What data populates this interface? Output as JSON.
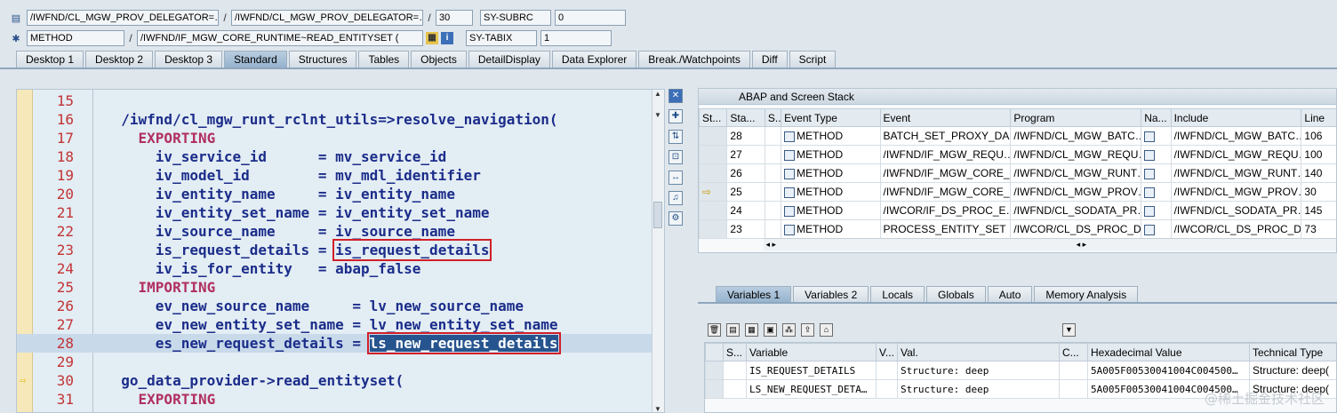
{
  "header": {
    "row1": {
      "field1": "/IWFND/CL_MGW_PROV_DELEGATOR=…",
      "field2": "/IWFND/CL_MGW_PROV_DELEGATOR=…",
      "field3": "30",
      "sysvar_label": "SY-SUBRC",
      "sysvar_value": "0"
    },
    "row2": {
      "field1": "METHOD",
      "field2": "/IWFND/IF_MGW_CORE_RUNTIME~READ_ENTITYSET (",
      "sysvar_label": "SY-TABIX",
      "sysvar_value": "1"
    }
  },
  "tabs": [
    "Desktop 1",
    "Desktop 2",
    "Desktop 3",
    "Standard",
    "Structures",
    "Tables",
    "Objects",
    "DetailDisplay",
    "Data Explorer",
    "Break./Watchpoints",
    "Diff",
    "Script"
  ],
  "active_tab": "Standard",
  "code": {
    "lines": [
      {
        "n": "15",
        "t": ""
      },
      {
        "n": "16",
        "t": "  /iwfnd/cl_mgw_runt_rclnt_utils=>resolve_navigation("
      },
      {
        "n": "17",
        "t": "    EXPORTING"
      },
      {
        "n": "18",
        "t": "      iv_service_id      = mv_service_id"
      },
      {
        "n": "19",
        "t": "      iv_model_id        = mv_mdl_identifier"
      },
      {
        "n": "20",
        "t": "      iv_entity_name     = iv_entity_name"
      },
      {
        "n": "21",
        "t": "      iv_entity_set_name = iv_entity_set_name"
      },
      {
        "n": "22",
        "t": "      iv_source_name     = iv_source_name"
      },
      {
        "n": "23",
        "t": "      is_request_details = ",
        "boxed": "is_request_details"
      },
      {
        "n": "24",
        "t": "      iv_is_for_entity   = abap_false"
      },
      {
        "n": "25",
        "t": "    IMPORTING"
      },
      {
        "n": "26",
        "t": "      ev_new_source_name     = lv_new_source_name"
      },
      {
        "n": "27",
        "t": "      ev_new_entity_set_name = lv_new_entity_set_name"
      },
      {
        "n": "28",
        "t": "      es_new_request_details = ",
        "boxed": "ls_new_request_details"
      },
      {
        "n": "29",
        "t": ""
      },
      {
        "n": "30",
        "t": "  go_data_provider->read_entityset("
      },
      {
        "n": "31",
        "t": "    EXPORTING"
      }
    ]
  },
  "stack": {
    "title": "ABAP and Screen Stack",
    "columns": [
      "St...",
      "Sta...",
      "S...",
      "Event Type",
      "Event",
      "Program",
      "Na...",
      "Include",
      "Line"
    ],
    "rows": [
      {
        "st": "",
        "level": "28",
        "type": "METHOD",
        "event": "BATCH_SET_PROXY_DA…",
        "program": "/IWFND/CL_MGW_BATC…",
        "include": "/IWFND/CL_MGW_BATC…",
        "line": "106"
      },
      {
        "st": "",
        "level": "27",
        "type": "METHOD",
        "event": "/IWFND/IF_MGW_REQU…",
        "program": "/IWFND/CL_MGW_REQU…",
        "include": "/IWFND/CL_MGW_REQU…",
        "line": "100"
      },
      {
        "st": "",
        "level": "26",
        "type": "METHOD",
        "event": "/IWFND/IF_MGW_CORE_…",
        "program": "/IWFND/CL_MGW_RUNT…",
        "include": "/IWFND/CL_MGW_RUNT…",
        "line": "140"
      },
      {
        "st": "⇨",
        "level": "25",
        "type": "METHOD",
        "event": "/IWFND/IF_MGW_CORE_…",
        "program": "/IWFND/CL_MGW_PROV…",
        "include": "/IWFND/CL_MGW_PROV…",
        "line": "30"
      },
      {
        "st": "",
        "level": "24",
        "type": "METHOD",
        "event": "/IWCOR/IF_DS_PROC_E…",
        "program": "/IWFND/CL_SODATA_PR…",
        "include": "/IWFND/CL_SODATA_PR…",
        "line": "145"
      },
      {
        "st": "",
        "level": "23",
        "type": "METHOD",
        "event": "PROCESS_ENTITY_SET",
        "program": "/IWCOR/CL_DS_PROC_D…",
        "include": "/IWCOR/CL_DS_PROC_D…",
        "line": "73"
      }
    ]
  },
  "var_tabs": [
    "Variables 1",
    "Variables 2",
    "Locals",
    "Globals",
    "Auto",
    "Memory Analysis"
  ],
  "var_active": "Variables 1",
  "variables": {
    "columns": [
      "S...",
      "Variable",
      "V...",
      "Val.",
      "C...",
      "Hexadecimal Value",
      "Technical Type"
    ],
    "rows": [
      {
        "name": "IS_REQUEST_DETAILS",
        "value": "Structure: deep",
        "hex": "5A005F00530041004C004500…",
        "type": "Structure: deep("
      },
      {
        "name": "LS_NEW_REQUEST_DETA…",
        "value": "Structure: deep",
        "hex": "5A005F00530041004C004500…",
        "type": "Structure: deep("
      }
    ]
  },
  "watermark": "@稀土掘金技术社区"
}
